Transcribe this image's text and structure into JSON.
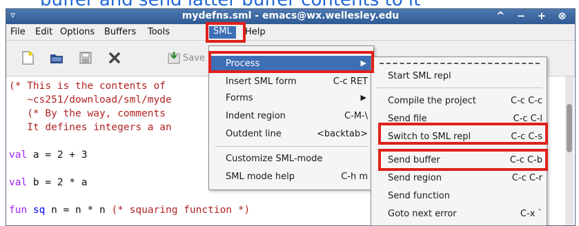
{
  "caption": "buffer and send latter buffer contents to it",
  "window": {
    "title": "mydefns.sml - emacs@wx.wellesley.edu",
    "window_menu_glyph": "▿",
    "controls": "^ − + ⊗"
  },
  "menubar": {
    "items": [
      "File",
      "Edit",
      "Options",
      "Buffers",
      "Tools",
      "SML",
      "Help"
    ]
  },
  "toolbar": {
    "save_label": "Save",
    "icons": [
      "new-file-icon",
      "open-folder-icon",
      "save-disk-icon",
      "close-x-icon",
      "save-buffer-icon"
    ]
  },
  "editor": {
    "lines": [
      "(* This is the contents of",
      "   ~cs251/download/sml/myde",
      "   (* By the way, comments",
      "   It defines integers a an",
      "",
      "val a = 2 + 3",
      "",
      "val b = 2 * a",
      "",
      "fun sq n = n * n (* squaring function *)"
    ],
    "line6": {
      "kw": "val",
      "rest": " a = 2 + 3"
    },
    "line8": {
      "kw": "val",
      "rest": " b = 2 * a"
    },
    "line10": {
      "kw": "fun",
      "name": " sq",
      "rest": " n = n * n ",
      "comment": "(* squaring function *)"
    }
  },
  "sml_menu": {
    "items": [
      {
        "label": "Process",
        "key": "",
        "submenu": true,
        "highlighted": true
      },
      {
        "label": "Insert SML form",
        "key": "C-c RET",
        "submenu": false
      },
      {
        "label": "Forms",
        "key": "",
        "submenu": true
      },
      {
        "label": "Indent region",
        "key": "C-M-\\",
        "submenu": false
      },
      {
        "label": "Outdent line",
        "key": "<backtab>",
        "submenu": false
      },
      {
        "label": "Customize SML-mode",
        "key": "",
        "submenu": false
      },
      {
        "label": "SML mode help",
        "key": "C-h m",
        "submenu": false
      }
    ]
  },
  "process_menu": {
    "items": [
      {
        "label": "Start SML repl",
        "key": ""
      },
      {
        "label": "Compile the project",
        "key": "C-c C-c"
      },
      {
        "label": "Send file",
        "key": "C-c C-l"
      },
      {
        "label": "Switch to SML repl",
        "key": "C-c C-s"
      },
      {
        "label": "Send buffer",
        "key": "C-c C-b"
      },
      {
        "label": "Send region",
        "key": "C-c C-r"
      },
      {
        "label": "Send function",
        "key": ""
      },
      {
        "label": "Goto next error",
        "key": "C-x `"
      }
    ]
  },
  "colors": {
    "highlight_box": "#e0201c",
    "selected_row": "#3e6fb5",
    "titlebar": "#3a669f",
    "caption": "#1f66d6"
  }
}
